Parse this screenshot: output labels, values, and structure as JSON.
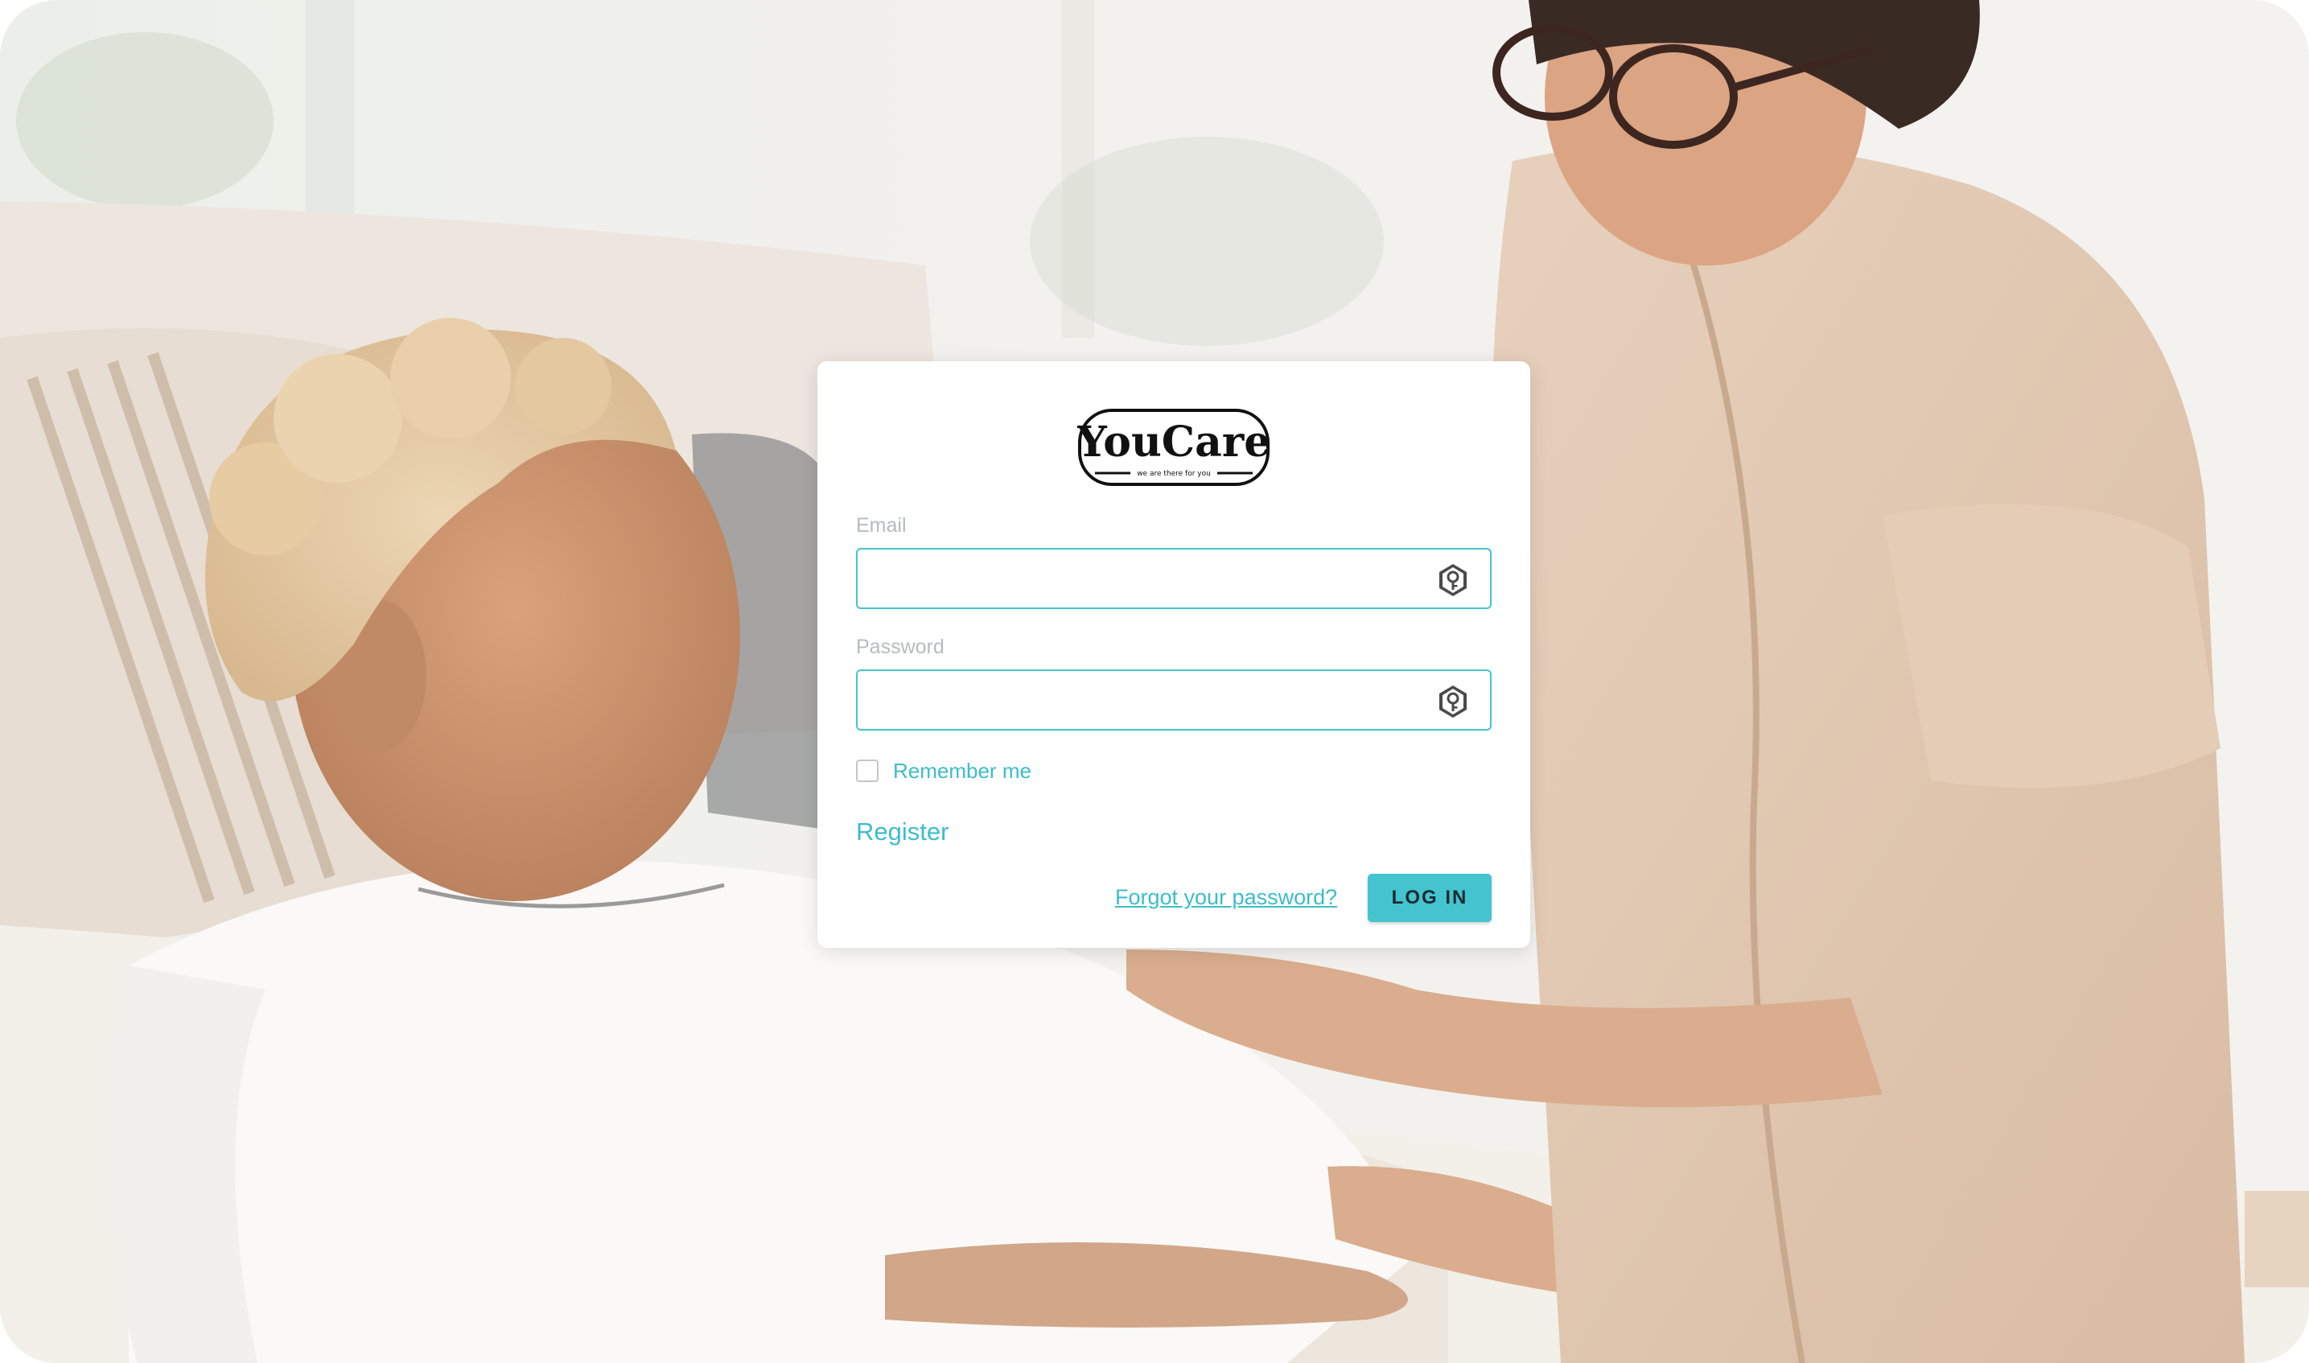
{
  "brand": {
    "name": "YouCare",
    "tagline": "we are there for you"
  },
  "form": {
    "email_label": "Email",
    "email_value": "",
    "password_label": "Password",
    "password_value": "",
    "remember_label": "Remember me",
    "remember_checked": false,
    "register_label": "Register",
    "forgot_label": "Forgot your password?",
    "login_label": "LOG IN"
  },
  "icons": {
    "email_field_icon": "password-manager-key-icon",
    "password_field_icon": "password-manager-key-icon"
  },
  "colors": {
    "accent": "#44c4cf",
    "label_muted": "#b5bcbf",
    "card_bg": "#ffffff"
  }
}
